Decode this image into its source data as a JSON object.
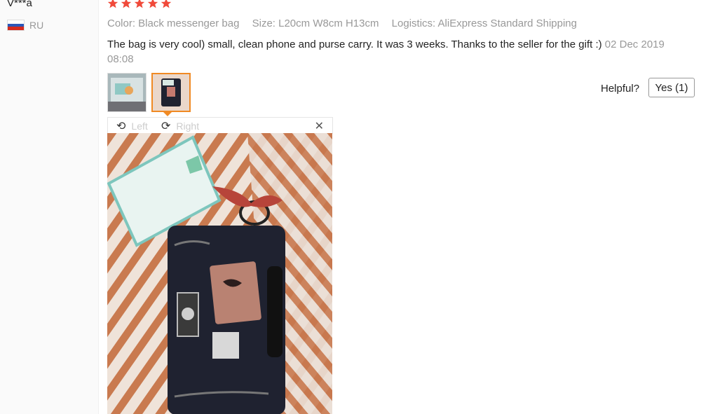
{
  "reviewer": {
    "name": "V***a",
    "country": "RU"
  },
  "rating": {
    "stars": 5,
    "max": 5,
    "color": "#f04a3a"
  },
  "attributes": [
    "Color: Black messenger bag",
    "Size: L20cm W8cm H13cm",
    "Logistics: AliExpress Standard Shipping"
  ],
  "review": {
    "text": "The bag is very cool) small, clean phone and purse carry. It was 3 weeks. Thanks to the seller for the gift :)",
    "date": "02 Dec 2019 08:08"
  },
  "helpful": {
    "label": "Helpful?",
    "button": "Yes (1)"
  },
  "viewer": {
    "rotate_left": "Left",
    "rotate_right": "Right",
    "active_thumbnail": 2
  },
  "colors": {
    "accent": "#f08a24",
    "muted": "#999999",
    "star": "#f04a3a"
  }
}
